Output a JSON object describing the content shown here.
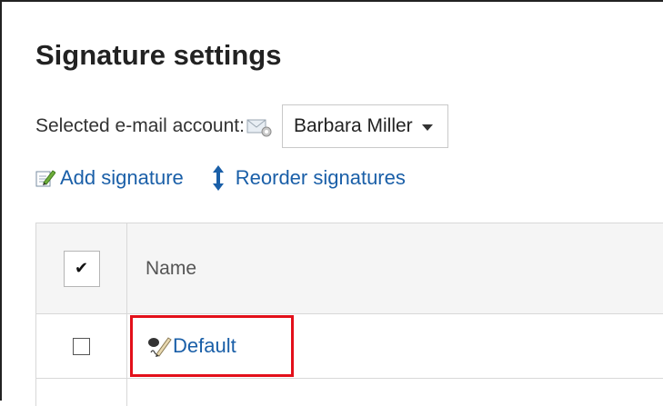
{
  "page": {
    "title": "Signature settings"
  },
  "account": {
    "label": "Selected e-mail account:",
    "selected": "Barbara Miller"
  },
  "actions": {
    "add_signature": "Add signature",
    "reorder_signatures": "Reorder signatures"
  },
  "table": {
    "header_check": "✔",
    "header_name": "Name",
    "rows": [
      {
        "name": "Default",
        "highlighted": true
      }
    ]
  },
  "colors": {
    "link": "#1a5fa8",
    "highlight_border": "#e3101a",
    "header_bg": "#f5f5f5"
  },
  "icons": {
    "mail_account": "mail-settings-icon",
    "add": "add-signature-icon",
    "reorder": "reorder-arrows-icon",
    "signature": "signature-pen-icon",
    "dropdown": "caret-down-icon"
  }
}
